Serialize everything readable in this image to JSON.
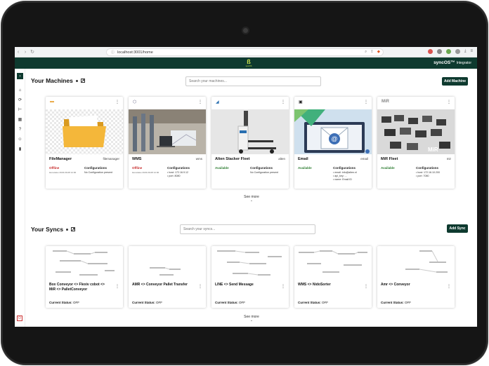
{
  "browser": {
    "url": "localhost:3001/home"
  },
  "header": {
    "logo_text": "syncOS",
    "brand": "syncOS™",
    "brand_sub": "Integrator"
  },
  "machines": {
    "title": "Your Machines",
    "search_placeholder": "Search your machines...",
    "add_label": "Add Machine",
    "see_more": "See more",
    "items": [
      {
        "name": "FileManager",
        "id": "filemanager",
        "status": "Offline",
        "sub": "last-status 2023-09-08 12:00",
        "conf_title": "Configurations",
        "conf_text": "No Configuration present",
        "conf_list": []
      },
      {
        "name": "WMS",
        "id": "wms",
        "status": "Offline",
        "sub": "last-status 2023-09-08 12:00",
        "conf_title": "Configurations",
        "conf_text": "",
        "conf_list": [
          "host: 172.16.9.12",
          "port: 8080"
        ]
      },
      {
        "name": "Alten Stacker Fleet",
        "id": "alten",
        "status": "Available",
        "sub": "",
        "conf_title": "Configurations",
        "conf_text": "No Configuration present",
        "conf_list": []
      },
      {
        "name": "Email",
        "id": "email",
        "status": "Available",
        "sub": "",
        "conf_title": "Configurations",
        "conf_text": "",
        "conf_list": [
          "email: info@alten.nl",
          "api_key: ...",
          "name: Email ID"
        ]
      },
      {
        "name": "MiR Fleet",
        "id": "mir",
        "status": "Available",
        "sub": "",
        "conf_title": "Configurations",
        "conf_text": "",
        "conf_list": [
          "host: 172.16.10.200",
          "port: 7080"
        ]
      }
    ]
  },
  "syncs": {
    "title": "Your Syncs",
    "search_placeholder": "Search your syncs...",
    "add_label": "Add Sync",
    "see_more": "See more",
    "status_label": "Current Status:",
    "items": [
      {
        "name": "Box Conveyor <> Flexiv cobot <> MiR <> PalletConveyor",
        "status": "OFF"
      },
      {
        "name": "AMR <> Conveyor Pallet Transfer",
        "status": "OFF"
      },
      {
        "name": "LINE <> Send Message",
        "status": "OFF"
      },
      {
        "name": "WMS <> NidoSorter",
        "status": "OFF"
      },
      {
        "name": "Amr <> Conveyor",
        "status": "OFF"
      }
    ]
  }
}
